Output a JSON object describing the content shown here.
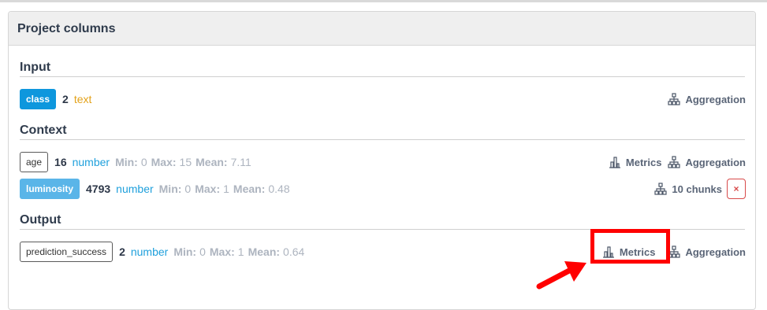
{
  "panel": {
    "title": "Project columns"
  },
  "sections": {
    "input": {
      "title": "Input"
    },
    "context": {
      "title": "Context"
    },
    "output": {
      "title": "Output"
    }
  },
  "columns": {
    "class": {
      "name": "class",
      "count": "2",
      "type": "text"
    },
    "age": {
      "name": "age",
      "count": "16",
      "type": "number",
      "min_label": "Min:",
      "min": "0",
      "max_label": "Max:",
      "max": "15",
      "mean_label": "Mean:",
      "mean": "7.11"
    },
    "luminosity": {
      "name": "luminosity",
      "count": "4793",
      "type": "number",
      "min_label": "Min:",
      "min": "0",
      "max_label": "Max:",
      "max": "1",
      "mean_label": "Mean:",
      "mean": "0.48"
    },
    "prediction_success": {
      "name": "prediction_success",
      "count": "2",
      "type": "number",
      "min_label": "Min:",
      "min": "0",
      "max_label": "Max:",
      "max": "1",
      "mean_label": "Mean:",
      "mean": "0.64"
    }
  },
  "actions": {
    "metrics": "Metrics",
    "aggregation": "Aggregation",
    "chunks": "10 chunks",
    "remove": "×"
  },
  "colors": {
    "tag_primary": "#0e97dd",
    "tag_light": "#5ab5e8",
    "type_text": "#e3a21a",
    "type_number": "#1fa0dc",
    "highlight": "#ff0000"
  },
  "icons": [
    "bar-chart-icon",
    "sitemap-icon",
    "arrow-icon"
  ]
}
